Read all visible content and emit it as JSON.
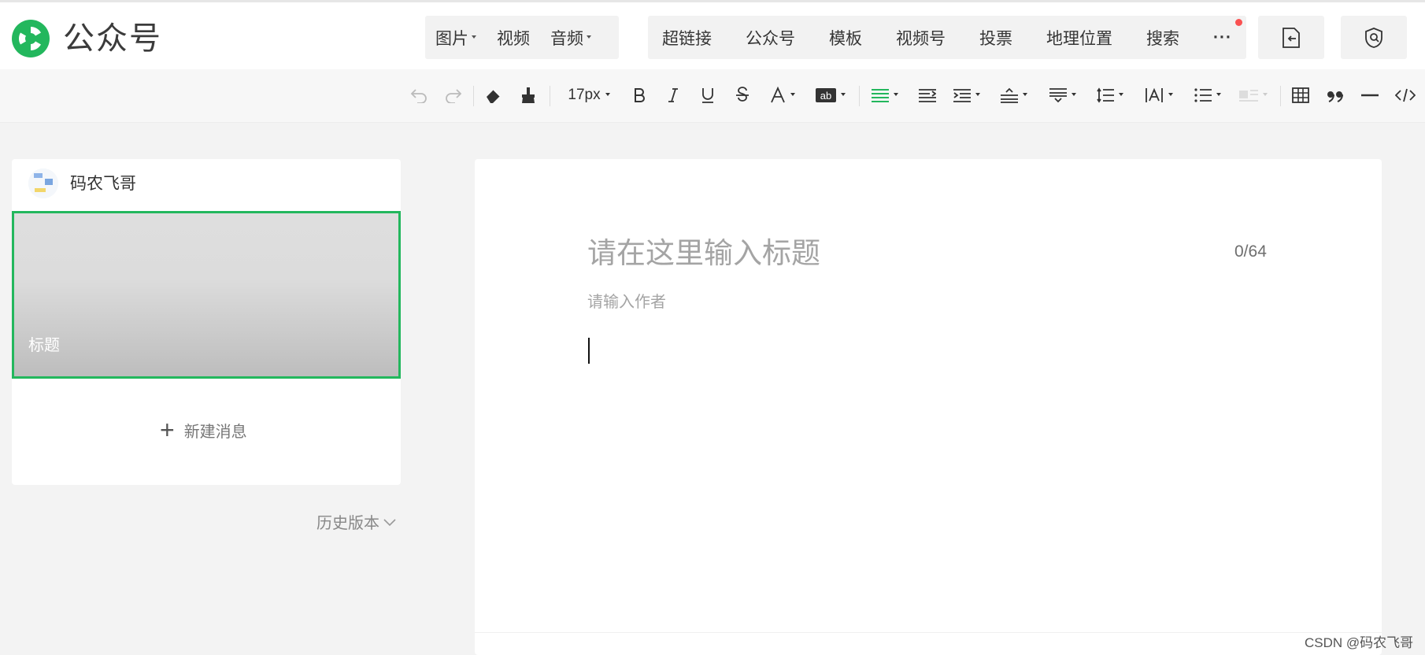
{
  "app": {
    "title": "公众号"
  },
  "media_menu": [
    {
      "label": "图片",
      "dropdown": true
    },
    {
      "label": "视频",
      "dropdown": false
    },
    {
      "label": "音频",
      "dropdown": true
    }
  ],
  "insert_menu": [
    {
      "label": "超链接"
    },
    {
      "label": "公众号"
    },
    {
      "label": "模板"
    },
    {
      "label": "视频号"
    },
    {
      "label": "投票"
    },
    {
      "label": "地理位置"
    },
    {
      "label": "搜索"
    },
    {
      "label": "···",
      "icon": "more-icon"
    }
  ],
  "toolbar": {
    "font_size": "17px"
  },
  "account": {
    "name": "码农飞哥"
  },
  "article": {
    "cover_title": "标题",
    "title_placeholder": "请在这里输入标题",
    "title_counter": "0/64",
    "author_placeholder": "请输入作者"
  },
  "left_panel": {
    "new_message": "新建消息",
    "history": "历史版本"
  },
  "watermark": "CSDN @码农飞哥",
  "colors": {
    "accent": "#23b75d",
    "notification_dot": "#fa5151"
  }
}
